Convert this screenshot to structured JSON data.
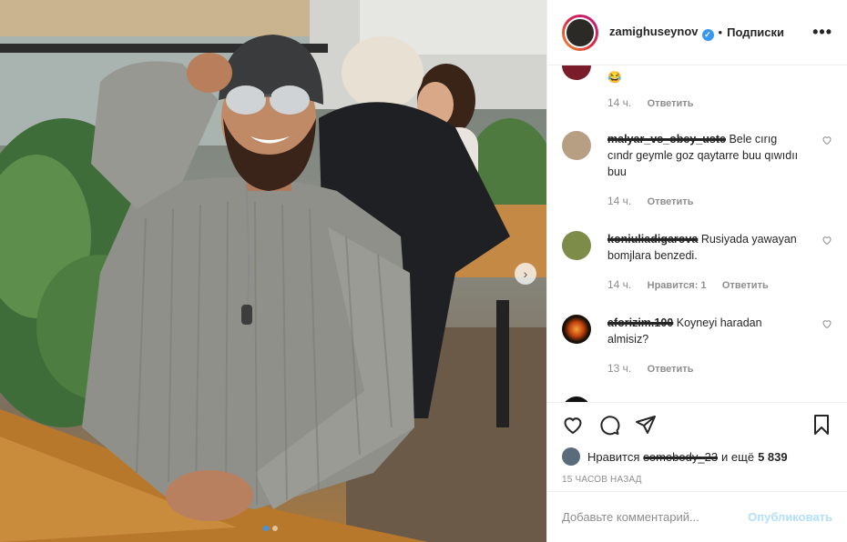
{
  "header": {
    "username": "zamighuseynov",
    "separator": "•",
    "follow_label": "Подписки",
    "more_label": "•••"
  },
  "comments": [
    {
      "text": "",
      "time": "14 ч.",
      "likes": "",
      "reply": "Ответить",
      "avatar_color": "#7a1c2a"
    },
    {
      "user": "malyar_vs_obey_uste",
      "text": "Bele cırıg cındr geymle goz qaytarre buu qıwıdıı buu",
      "time": "14 ч.",
      "likes": "",
      "reply": "Ответить",
      "avatar_color": "#b79f84"
    },
    {
      "user": "koniuliadigarova",
      "text": "Rusiyada yawayan bomjlara benzedi.",
      "time": "14 ч.",
      "likes": "Нравится: 1",
      "reply": "Ответить",
      "avatar_color": "#7e8c4a"
    },
    {
      "user": "aforizim.100",
      "text": "Koyneyi haradan almisiz?",
      "time": "13 ч.",
      "likes": "",
      "reply": "Ответить",
      "avatar_color": "#1a1208"
    }
  ],
  "likes": {
    "prefix": "Нравится",
    "liker": "somebody_23",
    "suffix": "и ещё",
    "count": "5 839"
  },
  "timestamp": "15 ЧАСОВ НАЗАД",
  "add_comment": {
    "placeholder": "Добавьте комментарий...",
    "publish_label": "Опубликовать"
  },
  "carousel": {
    "next_icon": "chevron-right-icon",
    "current": 1,
    "total": 2
  },
  "colors": {
    "accent": "#3897f0",
    "publish_disabled": "#b2dffc",
    "muted": "#8e8e8e"
  }
}
